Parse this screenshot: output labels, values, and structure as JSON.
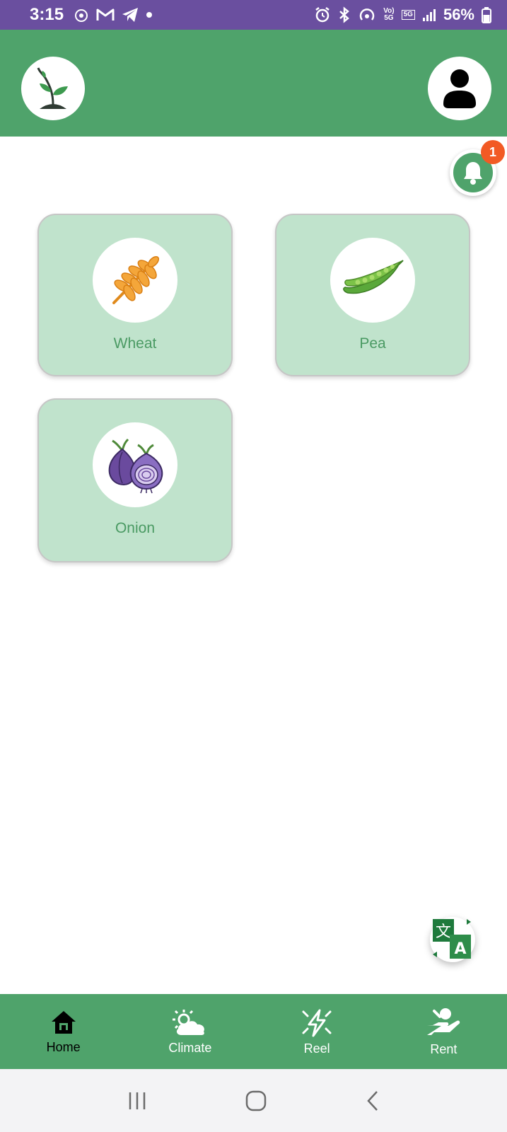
{
  "status_bar": {
    "time": "3:15",
    "network_top": "Vo)",
    "network_bottom": "5G",
    "cell_badge": "5G",
    "battery": "56%"
  },
  "notifications": {
    "count": "1"
  },
  "crops": [
    {
      "label": "Wheat",
      "icon": "wheat-icon"
    },
    {
      "label": "Pea",
      "icon": "pea-pod-icon"
    },
    {
      "label": "Onion",
      "icon": "onion-icon"
    }
  ],
  "bottom_nav": {
    "items": [
      {
        "label": "Home",
        "icon": "home-icon",
        "active": true
      },
      {
        "label": "Climate",
        "icon": "cloud-sun-icon",
        "active": false
      },
      {
        "label": "Reel",
        "icon": "lightning-icon",
        "active": false
      },
      {
        "label": "Rent",
        "icon": "hand-rent-icon",
        "active": false
      }
    ]
  },
  "colors": {
    "status_bar": "#6a4f9f",
    "primary_green": "#4fa36b",
    "card_bg": "#c0e3cc",
    "badge": "#f25a24"
  }
}
